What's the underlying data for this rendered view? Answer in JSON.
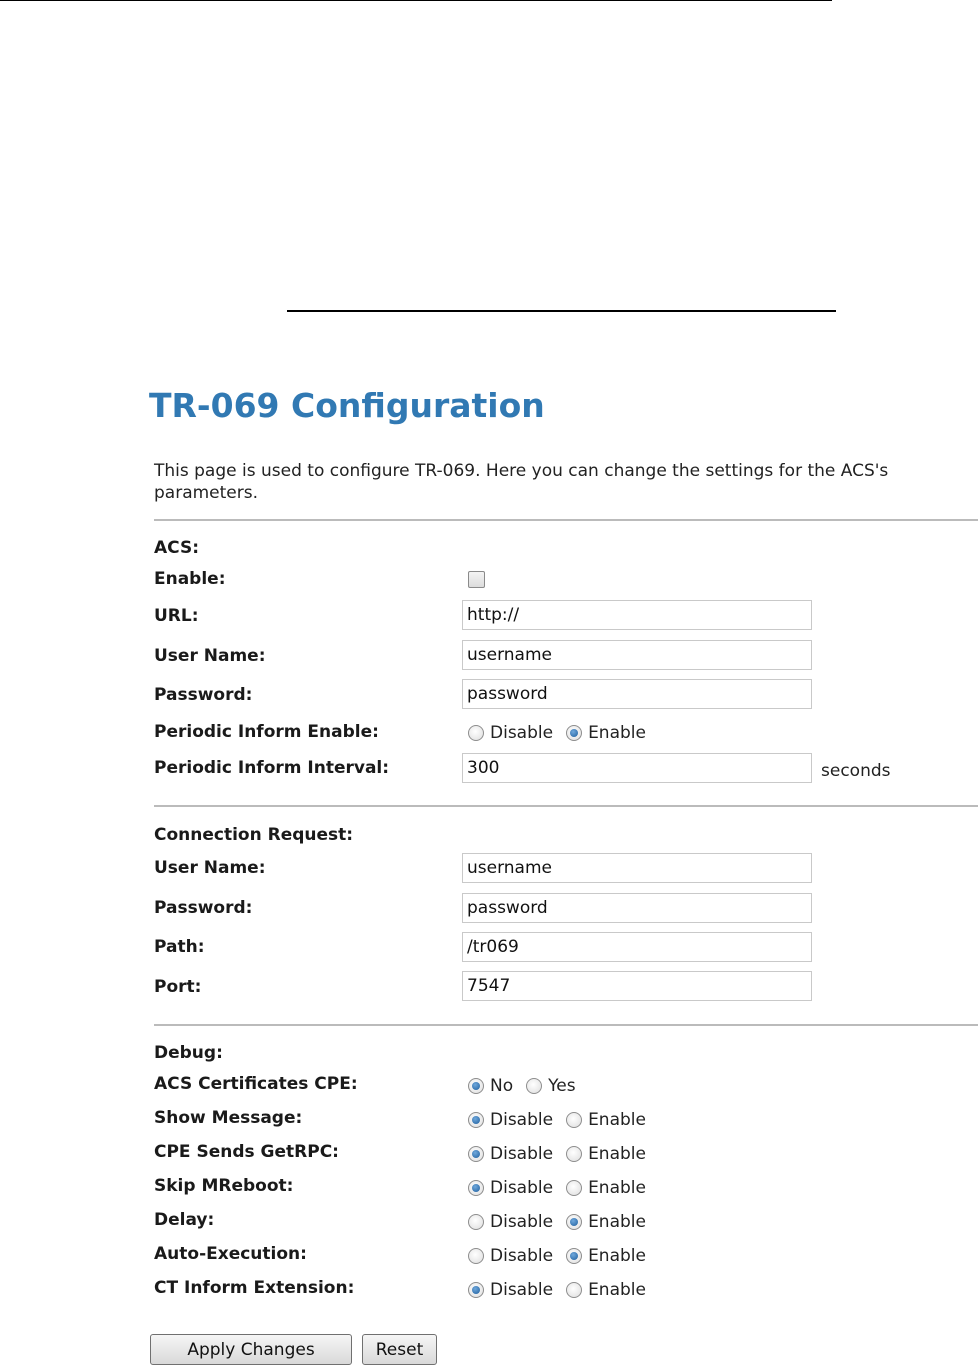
{
  "page": {
    "title": "TR-069 Configuration",
    "intro": "This page is used to configure TR-069. Here you can change the settings for the ACS's\nparameters."
  },
  "acs": {
    "section_label": "ACS:",
    "enable_label": "Enable:",
    "enable_checked": false,
    "url_label": "URL:",
    "url_value": "http://",
    "username_label": "User Name:",
    "username_value": "username",
    "password_label": "Password:",
    "password_value": "password",
    "periodic_enable_label": "Periodic Inform Enable:",
    "periodic_enable_options": [
      "Disable",
      "Enable"
    ],
    "periodic_enable_selected": "Enable",
    "periodic_interval_label": "Periodic Inform Interval:",
    "periodic_interval_value": "300",
    "periodic_interval_unit": "seconds"
  },
  "connection_request": {
    "section_label": "Connection Request:",
    "username_label": "User Name:",
    "username_value": "username",
    "password_label": "Password:",
    "password_value": "password",
    "path_label": "Path:",
    "path_value": "/tr069",
    "port_label": "Port:",
    "port_value": "7547"
  },
  "debug": {
    "section_label": "Debug:",
    "items": [
      {
        "label": "ACS Certificates CPE:",
        "options": [
          "No",
          "Yes"
        ],
        "selected": "No"
      },
      {
        "label": "Show Message:",
        "options": [
          "Disable",
          "Enable"
        ],
        "selected": "Disable"
      },
      {
        "label": "CPE Sends GetRPC:",
        "options": [
          "Disable",
          "Enable"
        ],
        "selected": "Disable"
      },
      {
        "label": "Skip MReboot:",
        "options": [
          "Disable",
          "Enable"
        ],
        "selected": "Disable"
      },
      {
        "label": "Delay:",
        "options": [
          "Disable",
          "Enable"
        ],
        "selected": "Enable"
      },
      {
        "label": "Auto-Execution:",
        "options": [
          "Disable",
          "Enable"
        ],
        "selected": "Enable"
      },
      {
        "label": "CT Inform Extension:",
        "options": [
          "Disable",
          "Enable"
        ],
        "selected": "Disable"
      }
    ]
  },
  "buttons": {
    "apply_label": "Apply Changes",
    "reset_label": "Reset"
  }
}
